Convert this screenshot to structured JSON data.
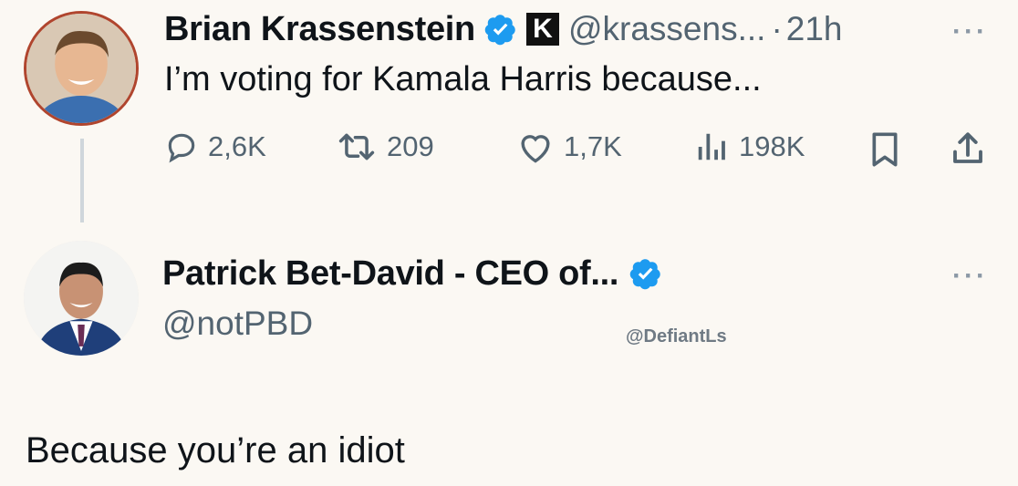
{
  "tweet": {
    "author_name": "Brian Krassenstein",
    "handle": "@krassens...",
    "separator": "·",
    "time": "21h",
    "badge_letter": "K",
    "text": "I’m voting for Kamala Harris because...",
    "stats": {
      "replies": "2,6K",
      "retweets": "209",
      "likes": "1,7K",
      "views": "198K"
    }
  },
  "reply": {
    "author_name": "Patrick Bet-David - CEO of...",
    "handle": "@notPBD",
    "text": "Because you’re an idiot"
  },
  "more_glyph": "···",
  "watermark": "@DefiantLs",
  "colors": {
    "verified": "#1d9bf0",
    "text": "#0f1419",
    "muted": "#536471",
    "background": "#fbf8f3"
  },
  "icons": [
    "verified-badge-icon",
    "reply-icon",
    "retweet-icon",
    "like-icon",
    "views-icon",
    "bookmark-icon",
    "share-icon",
    "more-icon"
  ]
}
